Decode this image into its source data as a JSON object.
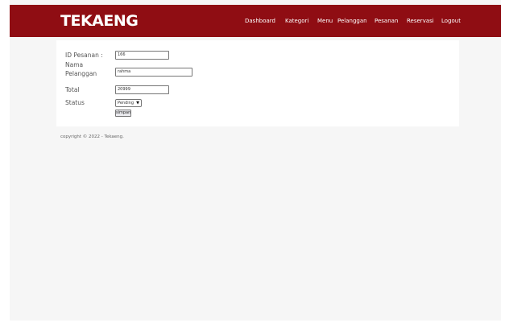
{
  "brand": "TEKAENG",
  "nav": {
    "dashboard": "Dashboard",
    "kategori": "Kategori",
    "menu": "Menu",
    "pelanggan": "Pelanggan",
    "pesanan": "Pesanan",
    "reservasi": "Reservasi",
    "logout": "Logout"
  },
  "form": {
    "id_label": "ID Pesanan :",
    "id_value": "166",
    "nama_label_line1": "Nama",
    "nama_label_line2": "Pelanggan",
    "nama_value": "rahma",
    "total_label": "Total",
    "total_value": "20999",
    "status_label": "Status",
    "status_value": "Pending",
    "submit_label": "simpan"
  },
  "footer": {
    "copyright": "copyright © 2022 - Tekaeng."
  },
  "colors": {
    "navbar": "#8f0d13"
  }
}
